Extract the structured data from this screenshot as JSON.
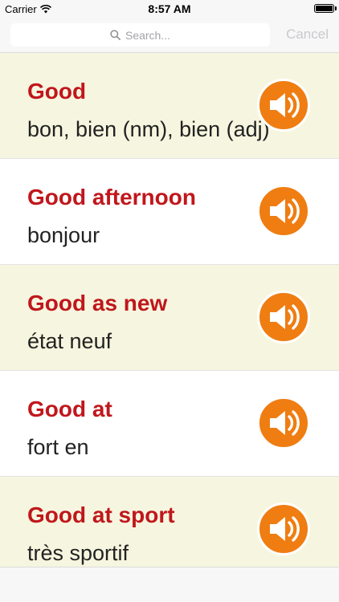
{
  "status_bar": {
    "carrier": "Carrier",
    "time": "8:57 AM"
  },
  "search": {
    "placeholder": "Search...",
    "cancel_label": "Cancel"
  },
  "entries": [
    {
      "term": "Good",
      "translation": "bon, bien (nm), bien (adj)"
    },
    {
      "term": "Good afternoon",
      "translation": "bonjour"
    },
    {
      "term": "Good as new",
      "translation": "état neuf"
    },
    {
      "term": "Good at",
      "translation": "fort en"
    },
    {
      "term": "Good at sport",
      "translation": "très sportif"
    }
  ],
  "colors": {
    "term": "#c0171c",
    "speaker": "#ef7d12",
    "alt_row": "#f6f6e0"
  },
  "icons": {
    "speaker": "speaker-icon",
    "search": "search-icon",
    "wifi": "wifi-icon",
    "battery": "battery-icon"
  }
}
